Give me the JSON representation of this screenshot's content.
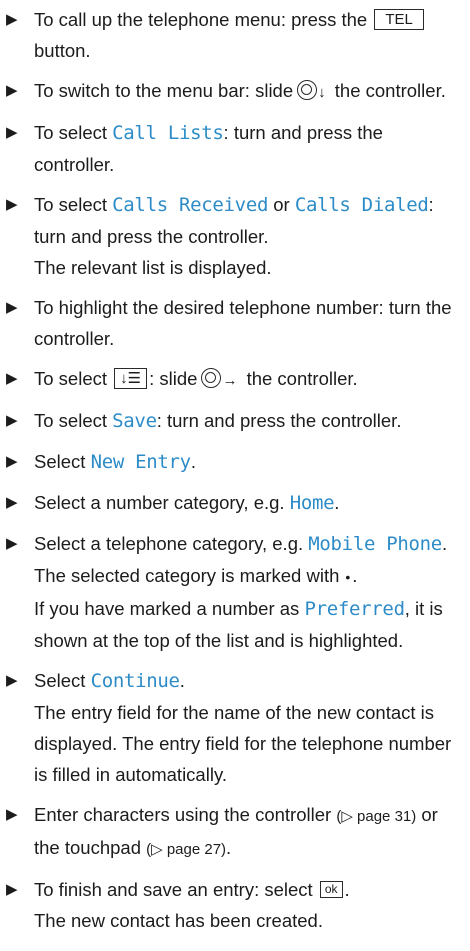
{
  "colors": {
    "text": "#1c1c1c",
    "highlight": "#2d8cc8"
  },
  "icons": {
    "bullet": "right-triangle-bullet-icon",
    "controller": "controller-knob-icon",
    "list_button": "list-menu-button-icon",
    "ok_button": "ok-button-icon"
  },
  "steps": [
    {
      "a": "To call up the telephone menu: press the",
      "key": "TEL",
      "b": "button."
    },
    {
      "a": "To switch to the menu bar: slide",
      "arrow": "↓",
      "b": "the controller."
    },
    {
      "a": "To select",
      "hl": "Call Lists",
      "b": ": turn and press the controller."
    },
    {
      "a": "To select",
      "hl1": "Calls Received",
      "mid": "or",
      "hl2": "Calls Dialed",
      "b": ": turn and press the controller.",
      "note": "The relevant list is displayed."
    },
    {
      "a": "To highlight the desired telephone number: turn the controller."
    },
    {
      "a": "To select",
      "key": "↓☰",
      "mid": ": slide",
      "arrow": "→",
      "b": "the controller."
    },
    {
      "a": "To select",
      "hl": "Save",
      "b": ": turn and press the controller."
    },
    {
      "a": "Select",
      "hl": "New Entry",
      "b": "."
    },
    {
      "a": "Select a number category, e.g.",
      "hl": "Home",
      "b": "."
    },
    {
      "a": "Select a telephone category, e.g.",
      "hl": "Mobile Phone",
      "b": ".",
      "note1a": "The selected category is marked with",
      "dot": "•",
      "note1b": ".",
      "note2a": "If you have marked a number as",
      "note2hl": "Preferred",
      "note2b": ", it is shown at the top of the list and is highlighted."
    },
    {
      "a": "Select",
      "hl": "Continue",
      "b": ".",
      "note": "The entry field for the name of the new contact is displayed. The entry field for the telephone number is filled in automatically."
    },
    {
      "a": "Enter characters using the controller",
      "ref1": "(▷ page 31)",
      "mid": "or the touchpad",
      "ref2": "(▷ page 27)",
      "b": "."
    },
    {
      "a": "To finish and save an entry: select",
      "key": "ok",
      "b": ".",
      "note": "The new contact has been created."
    }
  ]
}
